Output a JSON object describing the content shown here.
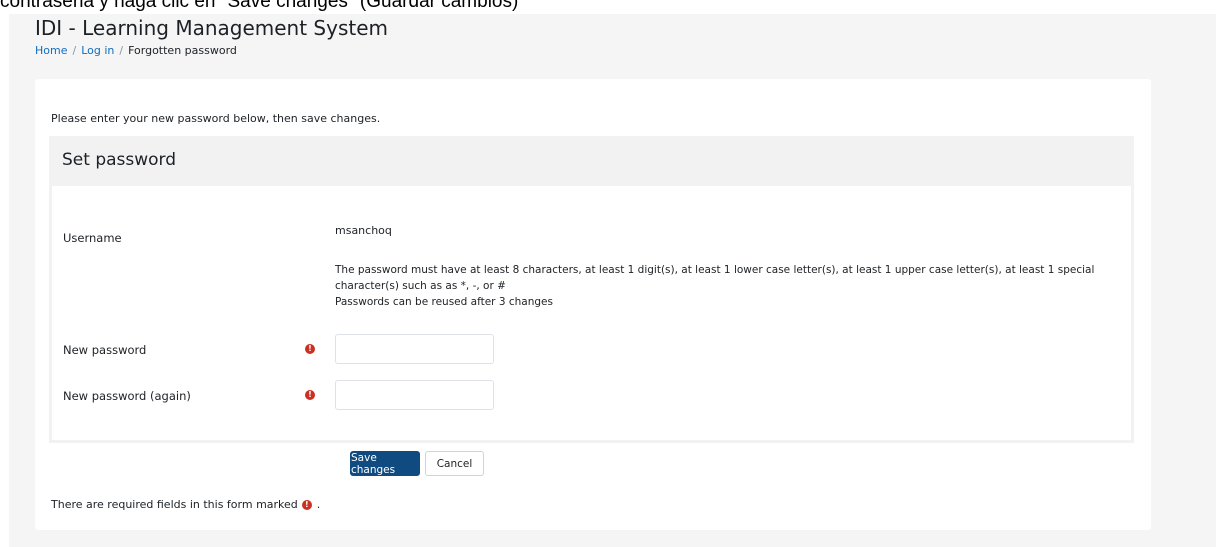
{
  "caption": "contraseña y haga clic en \"Save changes\" (Guardar cambios)",
  "site": {
    "title": "IDI - Learning Management System"
  },
  "breadcrumb": {
    "items": [
      {
        "label": "Home"
      },
      {
        "label": "Log in"
      },
      {
        "label": "Forgotten password"
      }
    ],
    "separator": "/"
  },
  "form": {
    "intro": "Please enter your new password below, then save changes.",
    "legend": "Set password",
    "username_label": "Username",
    "username_value": "msanchoq",
    "password_rules": "The password must have at least 8 characters, at least 1 digit(s), at least 1 lower case letter(s), at least 1 upper case letter(s), at least 1 special character(s) such as as *, -, or #",
    "reuse_note": "Passwords can be reused after 3 changes",
    "new_password_label": "New password",
    "new_password_value": "",
    "new_password_again_label": "New password (again)",
    "new_password_again_value": "",
    "required_icon": "exclamation-circle-icon",
    "save_label": "Save changes",
    "cancel_label": "Cancel",
    "required_note": "There are required fields in this form marked",
    "required_note_end": "."
  },
  "colors": {
    "link": "#0f6cbf",
    "primary_button": "#0f4a80",
    "required": "#ca3120",
    "page_background": "#f5f5f5"
  }
}
